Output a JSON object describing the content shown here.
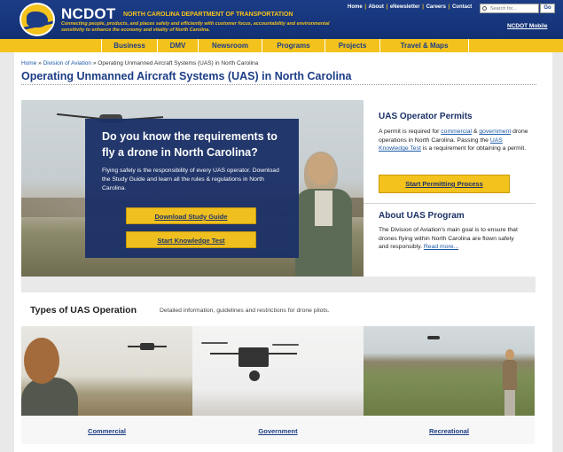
{
  "header": {
    "brand": "NCDOT",
    "brand_sub": "NORTH CAROLINA DEPARTMENT OF TRANSPORTATION",
    "tagline": "Connecting people, products, and places safely and efficiently with customer focus, accountability and environmental sensitivity to enhance the economy and vitality of North Carolina.",
    "top_links": [
      "Home",
      "About",
      "eNewsletter",
      "Careers",
      "Contact"
    ],
    "search_placeholder": "Search for...",
    "search_button": "Go",
    "mobile_link": "NCDOT Mobile"
  },
  "nav": {
    "items": [
      "Business",
      "DMV",
      "Newsroom",
      "Programs",
      "Projects",
      "Travel & Maps"
    ]
  },
  "breadcrumb": {
    "home": "Home",
    "sep": "»",
    "aviation": "Division of Aviation",
    "current": "Operating Unmanned Aircraft Systems (UAS) in North Carolina"
  },
  "page_title": "Operating Unmanned Aircraft Systems (UAS) in North Carolina",
  "hero": {
    "heading": "Do you know the requirements to fly a drone in North Carolina?",
    "body": "Flying safely is the responsibility of every UAS operator. Download the Study Guide and learn all the rules & regulations in North Carolina.",
    "btn_guide": "Download Study Guide",
    "btn_test": "Start Knowledge Test"
  },
  "permits": {
    "heading": "UAS Operator Permits",
    "text_1": "A permit is required for ",
    "link_commercial": "commercial",
    "text_2": " & ",
    "link_government": "government",
    "text_3": " drone operations in North Carolina. Passing the ",
    "link_test": "UAS Knowledge Test",
    "text_4": " is a requirement for obtaining a permit.",
    "button": "Start Permitting Process"
  },
  "about": {
    "heading": "About UAS Program",
    "body": "The Division of Aviation's main goal is to ensure that drones flying within North Carolina are flown safely and responsibly.",
    "read_more": "Read more..."
  },
  "types": {
    "heading": "Types of UAS Operation",
    "subheading": "Detailed information, guidelines and restrictions for drone pilots.",
    "cards": [
      "Commercial",
      "Government",
      "Recreational"
    ]
  }
}
